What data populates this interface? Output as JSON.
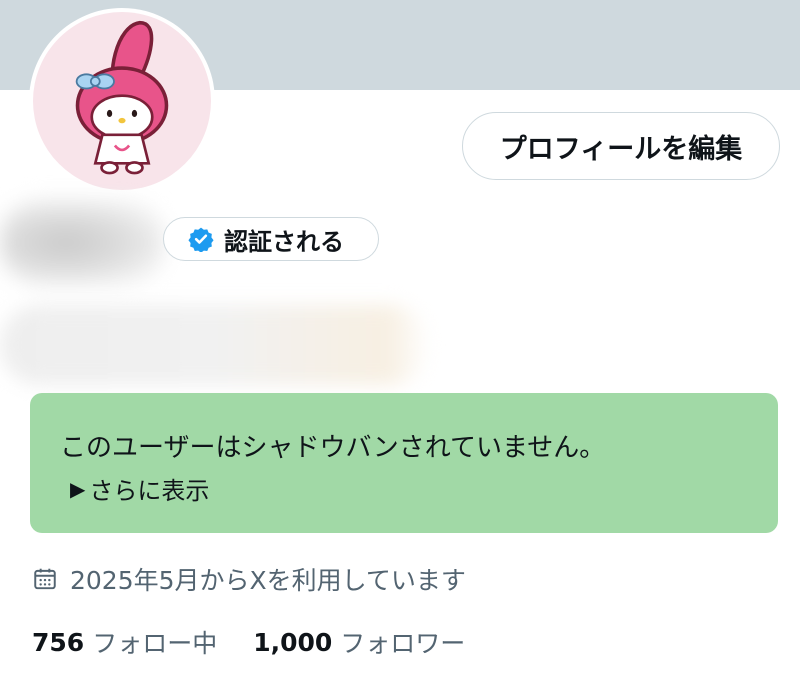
{
  "profile": {
    "edit_button_label": "プロフィールを編集",
    "verified_label": "認証される",
    "verified_badge_color": "#1d9bf0",
    "banner_color": "#cfd9de",
    "avatar_icon": "character-avatar"
  },
  "notice": {
    "message": "このユーザーはシャドウバンされていません。",
    "show_more_arrow": "▶",
    "show_more_label": "さらに表示",
    "background_color": "#a1d9a6"
  },
  "joined": {
    "icon": "calendar-icon",
    "text": "2025年5月からXを利用しています"
  },
  "stats": {
    "following_count": "756",
    "following_label": "フォロー中",
    "followers_count": "1,000",
    "followers_label": "フォロワー"
  }
}
